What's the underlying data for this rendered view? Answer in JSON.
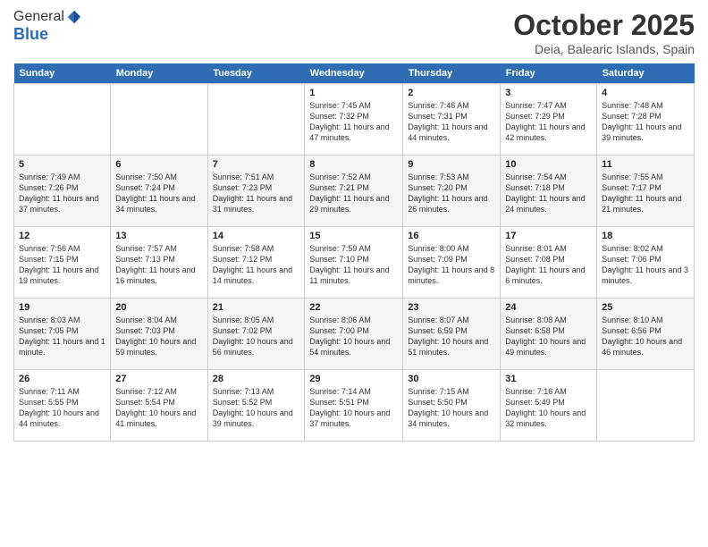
{
  "header": {
    "logo_line1": "General",
    "logo_line2": "Blue",
    "month_title": "October 2025",
    "location": "Deia, Balearic Islands, Spain"
  },
  "days_of_week": [
    "Sunday",
    "Monday",
    "Tuesday",
    "Wednesday",
    "Thursday",
    "Friday",
    "Saturday"
  ],
  "weeks": [
    [
      {
        "day": "",
        "info": ""
      },
      {
        "day": "",
        "info": ""
      },
      {
        "day": "",
        "info": ""
      },
      {
        "day": "1",
        "info": "Sunrise: 7:45 AM\nSunset: 7:32 PM\nDaylight: 11 hours and 47 minutes."
      },
      {
        "day": "2",
        "info": "Sunrise: 7:46 AM\nSunset: 7:31 PM\nDaylight: 11 hours and 44 minutes."
      },
      {
        "day": "3",
        "info": "Sunrise: 7:47 AM\nSunset: 7:29 PM\nDaylight: 11 hours and 42 minutes."
      },
      {
        "day": "4",
        "info": "Sunrise: 7:48 AM\nSunset: 7:28 PM\nDaylight: 11 hours and 39 minutes."
      }
    ],
    [
      {
        "day": "5",
        "info": "Sunrise: 7:49 AM\nSunset: 7:26 PM\nDaylight: 11 hours and 37 minutes."
      },
      {
        "day": "6",
        "info": "Sunrise: 7:50 AM\nSunset: 7:24 PM\nDaylight: 11 hours and 34 minutes."
      },
      {
        "day": "7",
        "info": "Sunrise: 7:51 AM\nSunset: 7:23 PM\nDaylight: 11 hours and 31 minutes."
      },
      {
        "day": "8",
        "info": "Sunrise: 7:52 AM\nSunset: 7:21 PM\nDaylight: 11 hours and 29 minutes."
      },
      {
        "day": "9",
        "info": "Sunrise: 7:53 AM\nSunset: 7:20 PM\nDaylight: 11 hours and 26 minutes."
      },
      {
        "day": "10",
        "info": "Sunrise: 7:54 AM\nSunset: 7:18 PM\nDaylight: 11 hours and 24 minutes."
      },
      {
        "day": "11",
        "info": "Sunrise: 7:55 AM\nSunset: 7:17 PM\nDaylight: 11 hours and 21 minutes."
      }
    ],
    [
      {
        "day": "12",
        "info": "Sunrise: 7:56 AM\nSunset: 7:15 PM\nDaylight: 11 hours and 19 minutes."
      },
      {
        "day": "13",
        "info": "Sunrise: 7:57 AM\nSunset: 7:13 PM\nDaylight: 11 hours and 16 minutes."
      },
      {
        "day": "14",
        "info": "Sunrise: 7:58 AM\nSunset: 7:12 PM\nDaylight: 11 hours and 14 minutes."
      },
      {
        "day": "15",
        "info": "Sunrise: 7:59 AM\nSunset: 7:10 PM\nDaylight: 11 hours and 11 minutes."
      },
      {
        "day": "16",
        "info": "Sunrise: 8:00 AM\nSunset: 7:09 PM\nDaylight: 11 hours and 8 minutes."
      },
      {
        "day": "17",
        "info": "Sunrise: 8:01 AM\nSunset: 7:08 PM\nDaylight: 11 hours and 6 minutes."
      },
      {
        "day": "18",
        "info": "Sunrise: 8:02 AM\nSunset: 7:06 PM\nDaylight: 11 hours and 3 minutes."
      }
    ],
    [
      {
        "day": "19",
        "info": "Sunrise: 8:03 AM\nSunset: 7:05 PM\nDaylight: 11 hours and 1 minute."
      },
      {
        "day": "20",
        "info": "Sunrise: 8:04 AM\nSunset: 7:03 PM\nDaylight: 10 hours and 59 minutes."
      },
      {
        "day": "21",
        "info": "Sunrise: 8:05 AM\nSunset: 7:02 PM\nDaylight: 10 hours and 56 minutes."
      },
      {
        "day": "22",
        "info": "Sunrise: 8:06 AM\nSunset: 7:00 PM\nDaylight: 10 hours and 54 minutes."
      },
      {
        "day": "23",
        "info": "Sunrise: 8:07 AM\nSunset: 6:59 PM\nDaylight: 10 hours and 51 minutes."
      },
      {
        "day": "24",
        "info": "Sunrise: 8:08 AM\nSunset: 6:58 PM\nDaylight: 10 hours and 49 minutes."
      },
      {
        "day": "25",
        "info": "Sunrise: 8:10 AM\nSunset: 6:56 PM\nDaylight: 10 hours and 46 minutes."
      }
    ],
    [
      {
        "day": "26",
        "info": "Sunrise: 7:11 AM\nSunset: 5:55 PM\nDaylight: 10 hours and 44 minutes."
      },
      {
        "day": "27",
        "info": "Sunrise: 7:12 AM\nSunset: 5:54 PM\nDaylight: 10 hours and 41 minutes."
      },
      {
        "day": "28",
        "info": "Sunrise: 7:13 AM\nSunset: 5:52 PM\nDaylight: 10 hours and 39 minutes."
      },
      {
        "day": "29",
        "info": "Sunrise: 7:14 AM\nSunset: 5:51 PM\nDaylight: 10 hours and 37 minutes."
      },
      {
        "day": "30",
        "info": "Sunrise: 7:15 AM\nSunset: 5:50 PM\nDaylight: 10 hours and 34 minutes."
      },
      {
        "day": "31",
        "info": "Sunrise: 7:16 AM\nSunset: 5:49 PM\nDaylight: 10 hours and 32 minutes."
      },
      {
        "day": "",
        "info": ""
      }
    ]
  ]
}
